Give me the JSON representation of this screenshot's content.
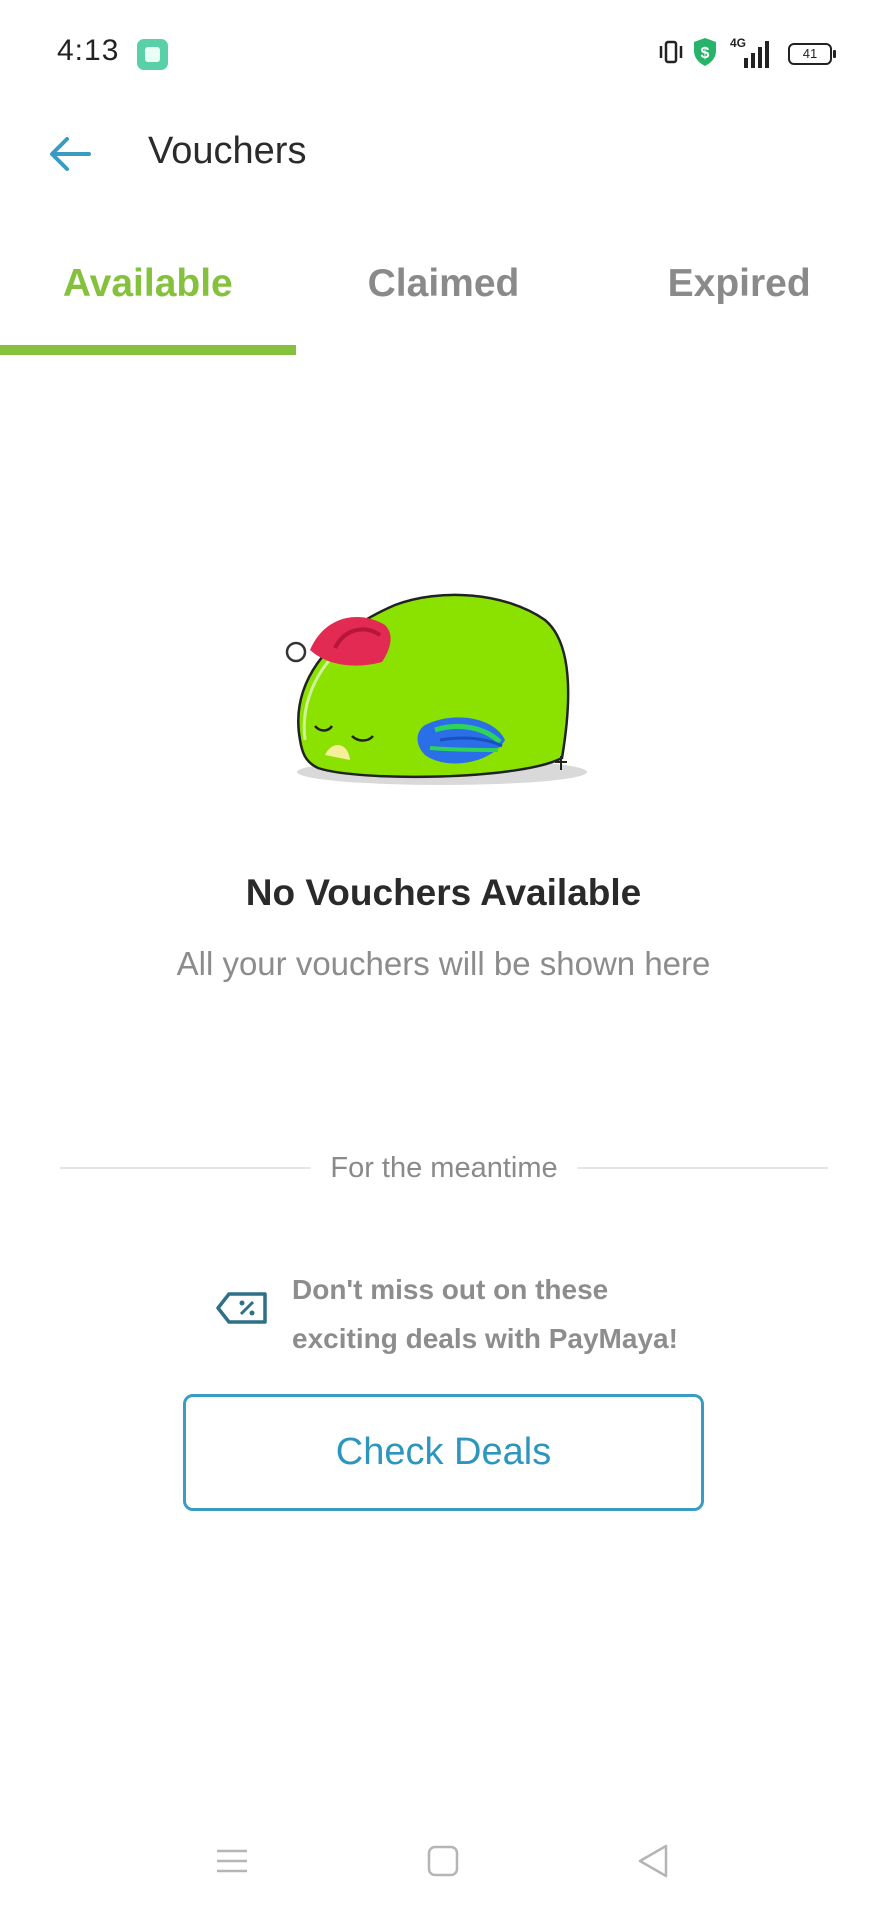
{
  "status_bar": {
    "time": "4:13",
    "network": "4G",
    "battery": "41",
    "icons": [
      "app-notification-icon",
      "vibrate-icon",
      "shield-dollar-icon",
      "signal-icon",
      "battery-icon"
    ]
  },
  "header": {
    "title": "Vouchers",
    "back_icon": "arrow-left-icon"
  },
  "tabs": [
    {
      "label": "Available",
      "active": true
    },
    {
      "label": "Claimed",
      "active": false
    },
    {
      "label": "Expired",
      "active": false
    }
  ],
  "empty_state": {
    "title": "No Vouchers Available",
    "subtitle": "All your vouchers will be shown here",
    "illustration": "sleeping-bird-with-santa-hat"
  },
  "divider": {
    "label": "For the meantime"
  },
  "promo": {
    "icon": "discount-tag-icon",
    "line1": "Don't miss out on these",
    "line2": "exciting deals with PayMaya!"
  },
  "cta": {
    "label": "Check Deals"
  },
  "nav_bar": {
    "icons": [
      "menu-icon",
      "home-icon",
      "back-icon"
    ]
  },
  "colors": {
    "accent_green": "#85c13d",
    "accent_blue": "#2d96bf",
    "text_dark": "#2a2a2a",
    "text_muted": "#8c8c8c"
  }
}
